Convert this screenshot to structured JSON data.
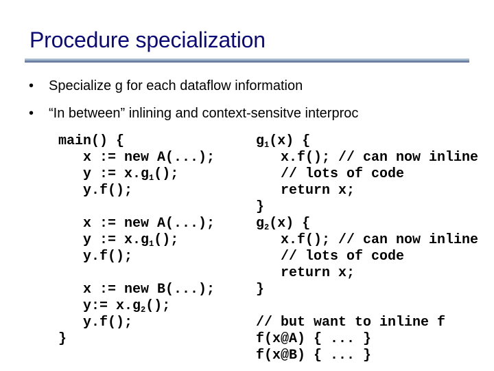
{
  "slide": {
    "title": "Procedure specialization",
    "bullets": [
      {
        "marker": "•",
        "text": "Specialize g for each dataflow information"
      },
      {
        "marker": "•",
        "text": "“In between” inlining and context-sensitve interproc"
      }
    ]
  },
  "code_left": {
    "lines": [
      {
        "pre": "main() {",
        "sub": "",
        "post": ""
      },
      {
        "pre": "   x := new A(...);",
        "sub": "",
        "post": ""
      },
      {
        "pre": "   y := x.g",
        "sub": "1",
        "post": "();"
      },
      {
        "pre": "   y.f();",
        "sub": "",
        "post": ""
      },
      {
        "pre": "",
        "sub": "",
        "post": ""
      },
      {
        "pre": "   x := new A(...);",
        "sub": "",
        "post": ""
      },
      {
        "pre": "   y := x.g",
        "sub": "1",
        "post": "();"
      },
      {
        "pre": "   y.f();",
        "sub": "",
        "post": ""
      },
      {
        "pre": "",
        "sub": "",
        "post": ""
      },
      {
        "pre": "   x := new B(...);",
        "sub": "",
        "post": ""
      },
      {
        "pre": "   y:= x.g",
        "sub": "2",
        "post": "();"
      },
      {
        "pre": "   y.f();",
        "sub": "",
        "post": ""
      },
      {
        "pre": "}",
        "sub": "",
        "post": ""
      }
    ]
  },
  "code_right": {
    "lines": [
      {
        "pre": "g",
        "sub": "1",
        "post": "(x) {"
      },
      {
        "pre": "   x.f(); // can now inline",
        "sub": "",
        "post": ""
      },
      {
        "pre": "   // lots of code",
        "sub": "",
        "post": ""
      },
      {
        "pre": "   return x;",
        "sub": "",
        "post": ""
      },
      {
        "pre": "}",
        "sub": "",
        "post": ""
      },
      {
        "pre": "g",
        "sub": "2",
        "post": "(x) {"
      },
      {
        "pre": "   x.f(); // can now inline",
        "sub": "",
        "post": ""
      },
      {
        "pre": "   // lots of code",
        "sub": "",
        "post": ""
      },
      {
        "pre": "   return x;",
        "sub": "",
        "post": ""
      },
      {
        "pre": "}",
        "sub": "",
        "post": ""
      },
      {
        "pre": "",
        "sub": "",
        "post": ""
      },
      {
        "pre": "// but want to inline f",
        "sub": "",
        "post": ""
      },
      {
        "pre": "f(x@A) { ... }",
        "sub": "",
        "post": ""
      },
      {
        "pre": "f(x@B) { ... }",
        "sub": "",
        "post": ""
      }
    ]
  },
  "colors": {
    "title": "#0a0a78",
    "body_text": "#000000",
    "rule_light": "#c3d4e4",
    "rule_dark": "#54688e"
  }
}
